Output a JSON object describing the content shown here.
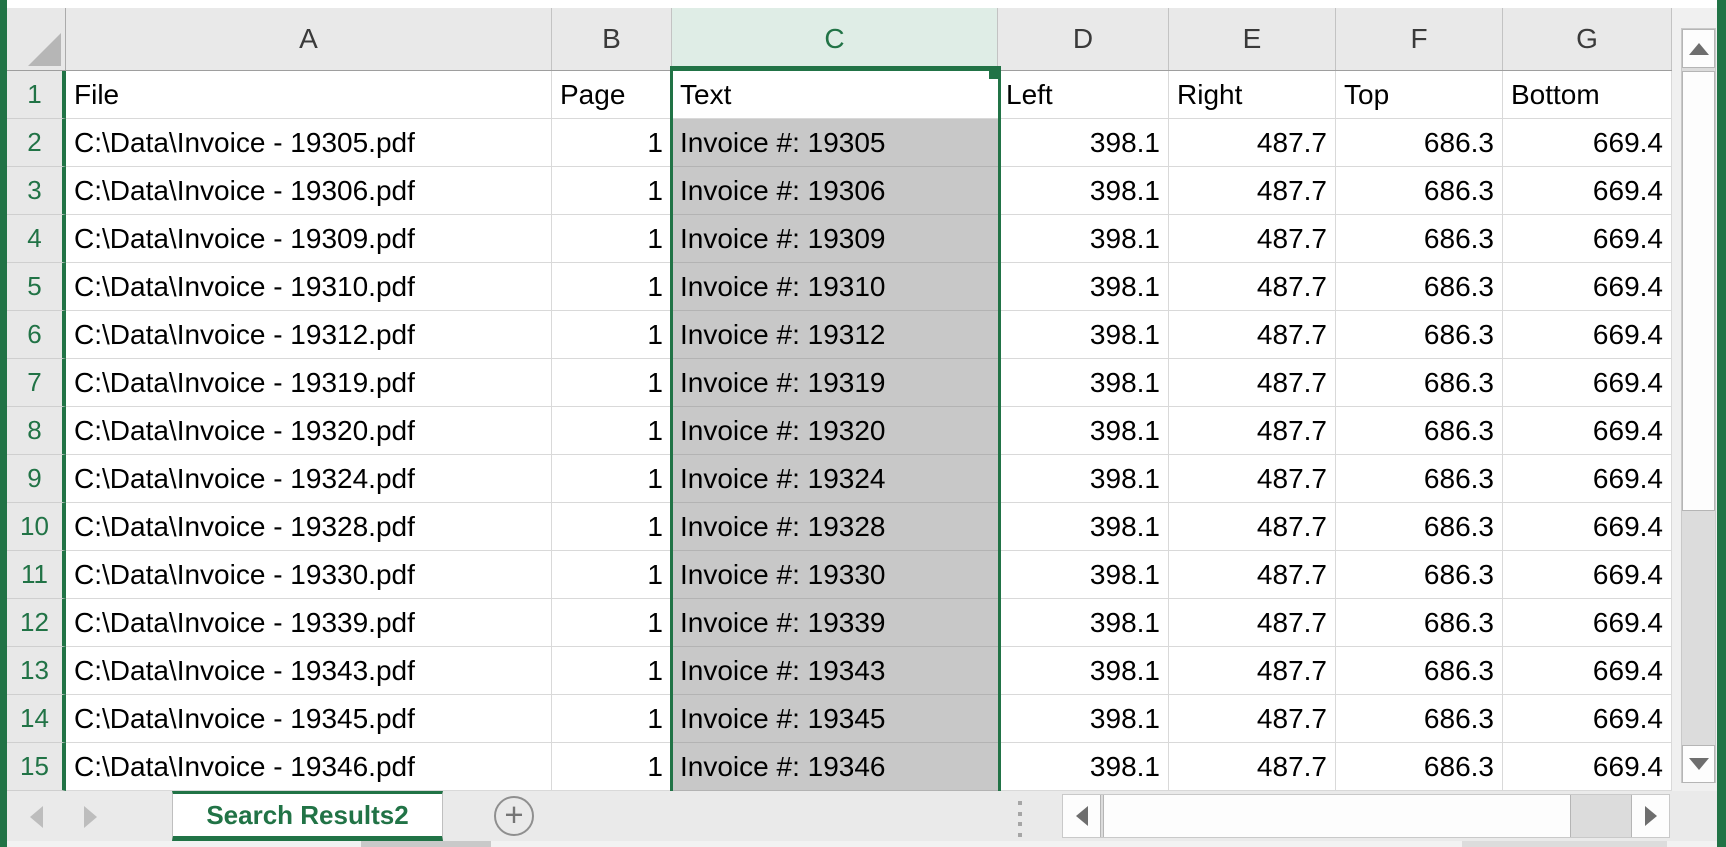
{
  "app": {
    "type": "spreadsheet",
    "frame_color": "#217346",
    "accent_green": "#217346"
  },
  "grid": {
    "column_headers": [
      "A",
      "B",
      "C",
      "D",
      "E",
      "F",
      "G"
    ],
    "row_numbers": [
      "1",
      "2",
      "3",
      "4",
      "5",
      "6",
      "7",
      "8",
      "9",
      "10",
      "11",
      "12",
      "13",
      "14",
      "15"
    ],
    "selected_column": "C",
    "active_cell": "C1",
    "select_all_icon": "select-all-triangle-icon"
  },
  "table": {
    "columns": [
      "File",
      "Page",
      "Text",
      "Left",
      "Right",
      "Top",
      "Bottom"
    ],
    "rows": [
      [
        "C:\\Data\\Invoice - 19305.pdf",
        "1",
        "Invoice #: 19305",
        "398.1",
        "487.7",
        "686.3",
        "669.4"
      ],
      [
        "C:\\Data\\Invoice - 19306.pdf",
        "1",
        "Invoice #: 19306",
        "398.1",
        "487.7",
        "686.3",
        "669.4"
      ],
      [
        "C:\\Data\\Invoice - 19309.pdf",
        "1",
        "Invoice #: 19309",
        "398.1",
        "487.7",
        "686.3",
        "669.4"
      ],
      [
        "C:\\Data\\Invoice - 19310.pdf",
        "1",
        "Invoice #: 19310",
        "398.1",
        "487.7",
        "686.3",
        "669.4"
      ],
      [
        "C:\\Data\\Invoice - 19312.pdf",
        "1",
        "Invoice #: 19312",
        "398.1",
        "487.7",
        "686.3",
        "669.4"
      ],
      [
        "C:\\Data\\Invoice - 19319.pdf",
        "1",
        "Invoice #: 19319",
        "398.1",
        "487.7",
        "686.3",
        "669.4"
      ],
      [
        "C:\\Data\\Invoice - 19320.pdf",
        "1",
        "Invoice #: 19320",
        "398.1",
        "487.7",
        "686.3",
        "669.4"
      ],
      [
        "C:\\Data\\Invoice - 19324.pdf",
        "1",
        "Invoice #: 19324",
        "398.1",
        "487.7",
        "686.3",
        "669.4"
      ],
      [
        "C:\\Data\\Invoice - 19328.pdf",
        "1",
        "Invoice #: 19328",
        "398.1",
        "487.7",
        "686.3",
        "669.4"
      ],
      [
        "C:\\Data\\Invoice - 19330.pdf",
        "1",
        "Invoice #: 19330",
        "398.1",
        "487.7",
        "686.3",
        "669.4"
      ],
      [
        "C:\\Data\\Invoice - 19339.pdf",
        "1",
        "Invoice #: 19339",
        "398.1",
        "487.7",
        "686.3",
        "669.4"
      ],
      [
        "C:\\Data\\Invoice - 19343.pdf",
        "1",
        "Invoice #: 19343",
        "398.1",
        "487.7",
        "686.3",
        "669.4"
      ],
      [
        "C:\\Data\\Invoice - 19345.pdf",
        "1",
        "Invoice #: 19345",
        "398.1",
        "487.7",
        "686.3",
        "669.4"
      ],
      [
        "C:\\Data\\Invoice - 19346.pdf",
        "1",
        "Invoice #: 19346",
        "398.1",
        "487.7",
        "686.3",
        "669.4"
      ]
    ]
  },
  "sheet_tabs": {
    "prev_icon": "chevron-left-icon",
    "next_icon": "chevron-right-icon",
    "active_label": "Search Results2",
    "add_label": "+",
    "add_icon": "plus-icon",
    "grip_icon": "drag-grip-icon"
  },
  "scrollbars": {
    "vertical": {
      "up_icon": "arrow-up-icon",
      "down_icon": "arrow-down-icon"
    },
    "horizontal": {
      "left_icon": "arrow-left-icon",
      "right_icon": "arrow-right-icon"
    }
  },
  "colors": {
    "excel_green": "#217346",
    "selected_header_bg": "#DFEDE6",
    "selection_fill": "#C8C8C8",
    "header_bg": "#E9E9E9",
    "gridline": "#D9D9D9"
  }
}
